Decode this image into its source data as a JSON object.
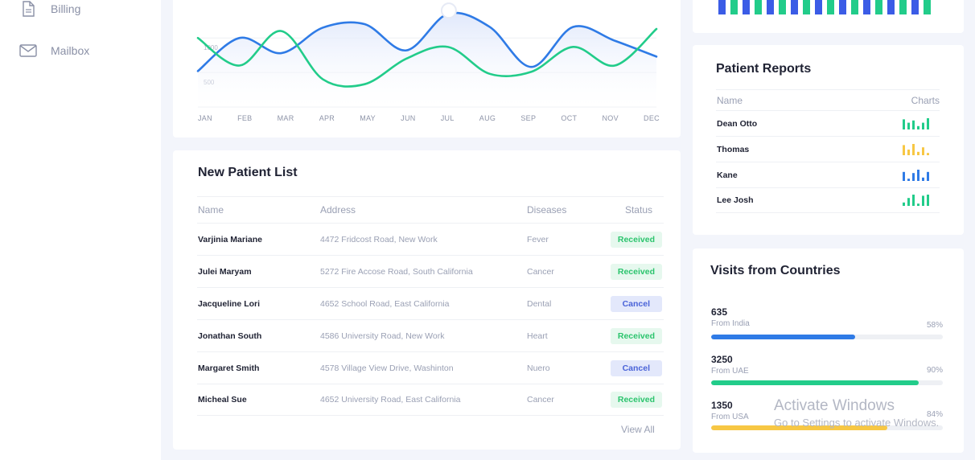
{
  "sidebar": {
    "items": [
      {
        "label": "Billing",
        "icon": "file-icon"
      },
      {
        "label": "Mailbox",
        "icon": "mail-icon"
      }
    ]
  },
  "colors": {
    "blue": "#2f7be6",
    "green": "#22cc8a",
    "accent": "#3b5ce6",
    "yellow": "#f7c744",
    "received": "#2bc46d",
    "cancel": "#4a63d8"
  },
  "chart_data": {
    "type": "line",
    "categories": [
      "JAN",
      "FEB",
      "MAR",
      "APR",
      "MAY",
      "JUN",
      "JUL",
      "AUG",
      "SEP",
      "OCT",
      "NOV",
      "DEC"
    ],
    "ytick_labels": [
      "1000",
      "500"
    ],
    "ylim": [
      0,
      1550
    ],
    "series": [
      {
        "color": "#2f7be6",
        "values": [
          520,
          1000,
          780,
          1150,
          1200,
          820,
          1350,
          1160,
          580,
          1160,
          960,
          730
        ]
      },
      {
        "color": "#22cc8a",
        "values": [
          1000,
          600,
          1100,
          400,
          330,
          700,
          870,
          480,
          510,
          870,
          600,
          1130
        ]
      }
    ]
  },
  "patient_list": {
    "title": "New Patient List",
    "columns": [
      "Name",
      "Address",
      "Diseases",
      "Status"
    ],
    "rows": [
      {
        "name": "Varjinia Mariane",
        "address": "4472 Fridcost Road, New Work",
        "disease": "Fever",
        "status": "Received"
      },
      {
        "name": "Julei Maryam",
        "address": "5272 Fire Accose Road, South California",
        "disease": "Cancer",
        "status": "Received"
      },
      {
        "name": "Jacqueline Lori",
        "address": "4652 School Road, East California",
        "disease": "Dental",
        "status": "Cancel"
      },
      {
        "name": "Jonathan South",
        "address": "4586 University Road, New Work",
        "disease": "Heart",
        "status": "Received"
      },
      {
        "name": "Margaret Smith",
        "address": "4578 Village View Drive, Washinton",
        "disease": "Nuero",
        "status": "Cancel"
      },
      {
        "name": "Micheal Sue",
        "address": "4652 University Road, East California",
        "disease": "Cancer",
        "status": "Received"
      }
    ],
    "view_all": "View All"
  },
  "patient_reports": {
    "title": "Patient Reports",
    "columns": [
      "Name",
      "Charts"
    ],
    "rows": [
      {
        "name": "Dean Otto",
        "color": "#22cc8a",
        "bars": [
          0.9,
          0.6,
          0.8,
          0.3,
          0.6,
          1.0
        ]
      },
      {
        "name": "Thomas",
        "color": "#f7c744",
        "bars": [
          0.9,
          0.5,
          1.0,
          0.3,
          0.7,
          0.2
        ]
      },
      {
        "name": "Kane",
        "color": "#2f7be6",
        "bars": [
          0.8,
          0.2,
          0.7,
          1.0,
          0.3,
          0.8
        ]
      },
      {
        "name": "Lee Josh",
        "color": "#22cc8a",
        "bars": [
          0.3,
          0.7,
          1.0,
          0.2,
          0.9,
          1.0
        ]
      }
    ]
  },
  "visits": {
    "title": "Visits from Countries",
    "items": [
      {
        "count": "635",
        "from": "From India",
        "percent_label": "58%",
        "percent": 0.62,
        "color": "#2f7be6"
      },
      {
        "count": "3250",
        "from": "From UAE",
        "percent_label": "90%",
        "percent": 0.895,
        "color": "#22cc8a"
      },
      {
        "count": "1350",
        "from": "From USA",
        "percent_label": "84%",
        "percent": 0.76,
        "color": "#f7c744"
      }
    ]
  },
  "top_bar_chart": {
    "colors": [
      "#3b5ce6",
      "#22cc8a"
    ]
  },
  "watermark": {
    "line1": "Activate Windows",
    "line2": "Go to Settings to activate Windows."
  }
}
